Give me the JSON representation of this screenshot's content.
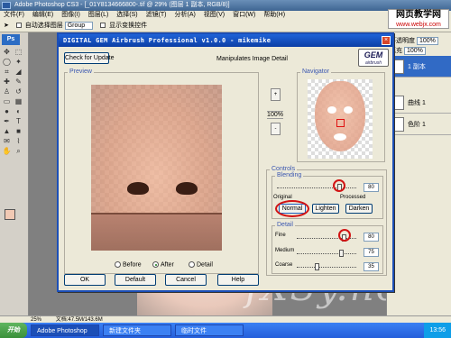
{
  "photoshop": {
    "title": "Adobe Photoshop CS3 - [_01Y8134666800-.tif @ 29% (图层 1 副本, RGB/8)]",
    "menus": [
      "文件(F)",
      "编辑(E)",
      "图像(I)",
      "图层(L)",
      "选择(S)",
      "滤镜(T)",
      "分析(A)",
      "视图(V)",
      "窗口(W)",
      "帮助(H)"
    ],
    "options": {
      "auto_select_label": "自动选择图层",
      "group_value": "Group",
      "show_transform_label": "显示变换控件"
    },
    "badge": "Ps",
    "watermark": {
      "line1": "网页教学网",
      "line2": "www.webjx.com"
    },
    "right_panel": {
      "opacity_label": "不透明度",
      "opacity_value": "100%",
      "fill_label": "填充",
      "fill_value": "100%",
      "layers": [
        {
          "name": "1 副本",
          "active": true
        },
        {
          "name": "曲线 1",
          "active": false
        },
        {
          "name": "色阶 1",
          "active": false
        }
      ]
    },
    "status": {
      "zoom": "25%",
      "doc": "文档:47.5M/143.6M"
    }
  },
  "taskbar": {
    "start": "开始",
    "items": [
      "Adobe Photoshop",
      "新建文件夹",
      "临时文件"
    ],
    "clock": "13:56"
  },
  "dialog": {
    "title": "DIGITAL GEM Airbrush Professional v1.0.0 - mikemike",
    "close": "×",
    "check_update": "Check for Update",
    "header_text": "Manipulates Image Detail",
    "logo": {
      "main": "GEM",
      "sub": "airbrush"
    },
    "preview_label": "Preview",
    "navigator_label": "Navigator",
    "zoom": {
      "plus": "+",
      "minus": "-",
      "value": "100%"
    },
    "view_modes": [
      {
        "label": "Before",
        "selected": false
      },
      {
        "label": "After",
        "selected": true
      },
      {
        "label": "Detail",
        "selected": false
      }
    ],
    "controls": {
      "label": "Controls",
      "blending": {
        "label": "Blending",
        "value": "80",
        "original_label": "Original",
        "processed_label": "Processed",
        "modes": [
          "Normal",
          "Lighten",
          "Darken"
        ],
        "selected_mode": "Normal",
        "level": 0.8
      },
      "detail": {
        "label": "Detail",
        "fine": {
          "label": "Fine",
          "value": "80",
          "level": 0.8
        },
        "medium": {
          "label": "Medium",
          "value": "75",
          "level": 0.75
        },
        "coarse": {
          "label": "Coarse",
          "value": "35",
          "level": 0.35
        }
      }
    },
    "buttons": {
      "ok": "OK",
      "default": "Default",
      "cancel": "Cancel",
      "help": "Help"
    }
  },
  "overlay_text": "fXSy.net",
  "colors": {
    "dialog_border": "#1c4fb7",
    "highlight_ring": "#d21313",
    "taskbar": "#245edb"
  }
}
